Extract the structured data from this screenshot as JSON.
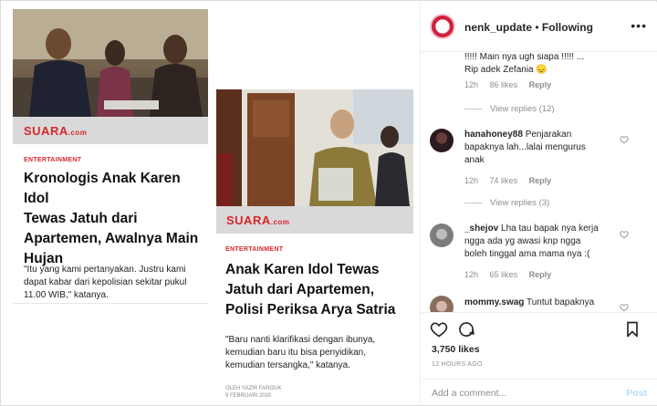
{
  "post": {
    "articles": [
      {
        "brand": "SUARA",
        "brand_suffix": ".com",
        "category": "ENTERTAINMENT",
        "headline_lines": [
          "Kronologis Anak Karen Idol",
          "Tewas Jatuh dari",
          "Apartemen, Awalnya Main",
          "Hujan"
        ],
        "quote_lines": [
          "\"Itu yang kami pertanyakan. Justru kami",
          "dapat kabar dari kepolisian sekitar pukul",
          "11.00 WIB,\" katanya."
        ]
      },
      {
        "brand": "SUARA",
        "brand_suffix": ".com",
        "category": "ENTERTAINMENT",
        "headline_lines": [
          "Anak Karen Idol Tewas",
          "Jatuh dari Apartemen,",
          "Polisi Periksa Arya Satria"
        ],
        "quote_lines": [
          "\"Baru nanti klarifikasi dengan ibunya,",
          "kemudian baru itu bisa penyidikan,",
          "kemudian tersangka,\" katanya."
        ],
        "byline": "OLEH YAZIR FAROUK",
        "date": "9 FEBRUARI 2020"
      }
    ]
  },
  "header": {
    "username": "nenk_update",
    "separator": "•",
    "follow_status": "Following",
    "more_icon": "more-horizontal-icon"
  },
  "comments": [
    {
      "text_line1": "!!!!! Main nya ugh siapa !!!!! ...",
      "text_line2": "Rip adek Zefania 😞",
      "time": "12h",
      "likes": "86 likes",
      "reply": "Reply",
      "view_replies": "View replies (12)"
    },
    {
      "username": "hanahoney88",
      "text_line1": "Penjarakan",
      "text_line2": "bapaknya lah...lalai mengurus",
      "text_line3": "anak",
      "time": "12h",
      "likes": "74 likes",
      "reply": "Reply",
      "view_replies": "View replies (3)"
    },
    {
      "username": "_shejov",
      "text_line1": "Lha tau bapak nya kerja",
      "text_line2": "ngga ada yg awasi knp ngga",
      "text_line3": "boleh tinggal ama mama nya :(",
      "time": "12h",
      "likes": "65 likes",
      "reply": "Reply"
    },
    {
      "username": "mommy.swag",
      "text_line1": "Tuntut bapaknya"
    }
  ],
  "actions": {
    "likes": "3,750 likes",
    "timestamp": "12 HOURS AGO"
  },
  "compose": {
    "placeholder": "Add a comment...",
    "post_label": "Post"
  },
  "colors": {
    "brand_red": "#d7272b",
    "post_disabled": "#b2dffc",
    "muted": "#8e8e8e"
  }
}
